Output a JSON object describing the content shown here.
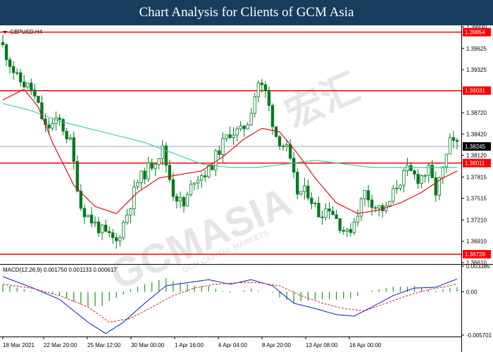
{
  "header": {
    "title": "Chart Analysis for Clients of GCM Asia"
  },
  "watermark": {
    "brand": "GCMASIA",
    "chinese": "宏汇",
    "subtitle": "GCM CAPITAL MARKETS"
  },
  "colors": {
    "header_bg": "#173d5e",
    "resistance_line": "#ff0000",
    "price_marker": "#a0a0c0",
    "candle": "#007a1e",
    "ma_fast": "#e00000",
    "ma_slow": "#33cc99",
    "macd_line": "#1a33cc",
    "macd_signal": "#e03333",
    "histogram": "#1a9d1a",
    "level_label_bg": "#ff0000",
    "current_label_bg": "#000000"
  },
  "chart_data": [
    {
      "type": "candlestick",
      "symbol": "GBPUSD,H4",
      "ylim": [
        1.3661,
        1.3993
      ],
      "y_ticks": [
        "1.39930",
        "1.39625",
        "1.39325",
        "1.38720",
        "1.38420",
        "1.38120",
        "1.37815",
        "1.37515",
        "1.37210",
        "1.36910",
        "1.36610"
      ],
      "x_ticks": [
        "18 Mar 2021",
        "22 Mar 20:00",
        "25 Mar 12:00",
        "30 Mar 00:00",
        "1 Apr 16:00",
        "6 Apr 04:00",
        "8 Apr 20:00",
        "13 Apr 08:00",
        "16 Apr 00:00"
      ],
      "levels": [
        {
          "value": 1.39854,
          "label": "1.39854"
        },
        {
          "value": 1.39031,
          "label": "1.39031"
        },
        {
          "value": 1.38011,
          "label": "1.38011"
        },
        {
          "value": 1.36728,
          "label": "1.36728"
        }
      ],
      "current_price": {
        "value": 1.38245,
        "label": "1.38245"
      },
      "candle_anchors_close": [
        [
          0,
          1.3965
        ],
        [
          4,
          1.392
        ],
        [
          8,
          1.3905
        ],
        [
          10,
          1.388
        ],
        [
          12,
          1.385
        ],
        [
          16,
          1.386
        ],
        [
          19,
          1.383
        ],
        [
          22,
          1.374
        ],
        [
          25,
          1.372
        ],
        [
          29,
          1.37
        ],
        [
          32,
          1.369
        ],
        [
          35,
          1.373
        ],
        [
          38,
          1.3775
        ],
        [
          42,
          1.38
        ],
        [
          45,
          1.382
        ],
        [
          48,
          1.376
        ],
        [
          51,
          1.374
        ],
        [
          54,
          1.378
        ],
        [
          58,
          1.379
        ],
        [
          61,
          1.382
        ],
        [
          64,
          1.3845
        ],
        [
          67,
          1.3845
        ],
        [
          69,
          1.386
        ],
        [
          72,
          1.3915
        ],
        [
          74,
          1.39
        ],
        [
          77,
          1.384
        ],
        [
          80,
          1.382
        ],
        [
          83,
          1.376
        ],
        [
          86,
          1.376
        ],
        [
          89,
          1.373
        ],
        [
          92,
          1.374
        ],
        [
          95,
          1.3715
        ],
        [
          97,
          1.37
        ],
        [
          99,
          1.372
        ],
        [
          102,
          1.376
        ],
        [
          105,
          1.374
        ],
        [
          108,
          1.3735
        ],
        [
          111,
          1.377
        ],
        [
          114,
          1.379
        ],
        [
          117,
          1.378
        ],
        [
          120,
          1.379
        ],
        [
          122,
          1.376
        ],
        [
          124,
          1.379
        ],
        [
          126,
          1.383
        ],
        [
          128,
          1.3825
        ]
      ],
      "ma_fast": [
        [
          0,
          1.389
        ],
        [
          6,
          1.3905
        ],
        [
          10,
          1.388
        ],
        [
          14,
          1.383
        ],
        [
          20,
          1.377
        ],
        [
          26,
          1.374
        ],
        [
          32,
          1.373
        ],
        [
          38,
          1.376
        ],
        [
          44,
          1.378
        ],
        [
          50,
          1.3785
        ],
        [
          56,
          1.379
        ],
        [
          62,
          1.381
        ],
        [
          68,
          1.3835
        ],
        [
          73,
          1.385
        ],
        [
          78,
          1.3845
        ],
        [
          83,
          1.3815
        ],
        [
          88,
          1.378
        ],
        [
          94,
          1.3745
        ],
        [
          100,
          1.373
        ],
        [
          106,
          1.3735
        ],
        [
          112,
          1.3745
        ],
        [
          118,
          1.376
        ],
        [
          124,
          1.378
        ],
        [
          128,
          1.379
        ]
      ],
      "ma_slow": [
        [
          0,
          1.3885
        ],
        [
          8,
          1.3875
        ],
        [
          16,
          1.386
        ],
        [
          24,
          1.385
        ],
        [
          32,
          1.384
        ],
        [
          40,
          1.383
        ],
        [
          48,
          1.3815
        ],
        [
          56,
          1.38
        ],
        [
          64,
          1.3795
        ],
        [
          72,
          1.3795
        ],
        [
          80,
          1.38
        ],
        [
          88,
          1.3805
        ],
        [
          96,
          1.38
        ],
        [
          104,
          1.3795
        ],
        [
          112,
          1.3795
        ],
        [
          120,
          1.3795
        ],
        [
          128,
          1.3795
        ]
      ]
    },
    {
      "type": "macd",
      "label": "MACD(12,26,9) 0.001750 0.001133 0.000617",
      "ylim": [
        -0.005701,
        0.003386
      ],
      "y_ticks": [
        "0.003386",
        "0.00",
        "-0.005701"
      ],
      "macd_line": [
        [
          0,
          0.002
        ],
        [
          8,
          0.0006
        ],
        [
          16,
          -0.001
        ],
        [
          24,
          -0.004
        ],
        [
          29,
          -0.0055
        ],
        [
          34,
          -0.004
        ],
        [
          40,
          -0.0015
        ],
        [
          46,
          0.0008
        ],
        [
          52,
          0.0012
        ],
        [
          58,
          0.0016
        ],
        [
          64,
          0.001
        ],
        [
          70,
          0.0016
        ],
        [
          76,
          0.0008
        ],
        [
          82,
          -0.0015
        ],
        [
          88,
          -0.0022
        ],
        [
          94,
          -0.003
        ],
        [
          99,
          -0.0032
        ],
        [
          104,
          -0.002
        ],
        [
          110,
          -0.0005
        ],
        [
          116,
          0.0005
        ],
        [
          122,
          0.0006
        ],
        [
          128,
          0.0017
        ]
      ],
      "signal_line": [
        [
          0,
          0.001
        ],
        [
          8,
          0.0005
        ],
        [
          16,
          -0.0005
        ],
        [
          24,
          -0.002
        ],
        [
          30,
          -0.004
        ],
        [
          36,
          -0.0035
        ],
        [
          42,
          -0.002
        ],
        [
          48,
          -0.0005
        ],
        [
          54,
          0.0005
        ],
        [
          60,
          0.001
        ],
        [
          66,
          0.0012
        ],
        [
          72,
          0.0012
        ],
        [
          78,
          0.0008
        ],
        [
          84,
          -0.0005
        ],
        [
          90,
          -0.0015
        ],
        [
          96,
          -0.0022
        ],
        [
          102,
          -0.0025
        ],
        [
          108,
          -0.0015
        ],
        [
          114,
          -0.0005
        ],
        [
          120,
          0.0003
        ],
        [
          126,
          0.0008
        ],
        [
          128,
          0.0011
        ]
      ]
    }
  ]
}
